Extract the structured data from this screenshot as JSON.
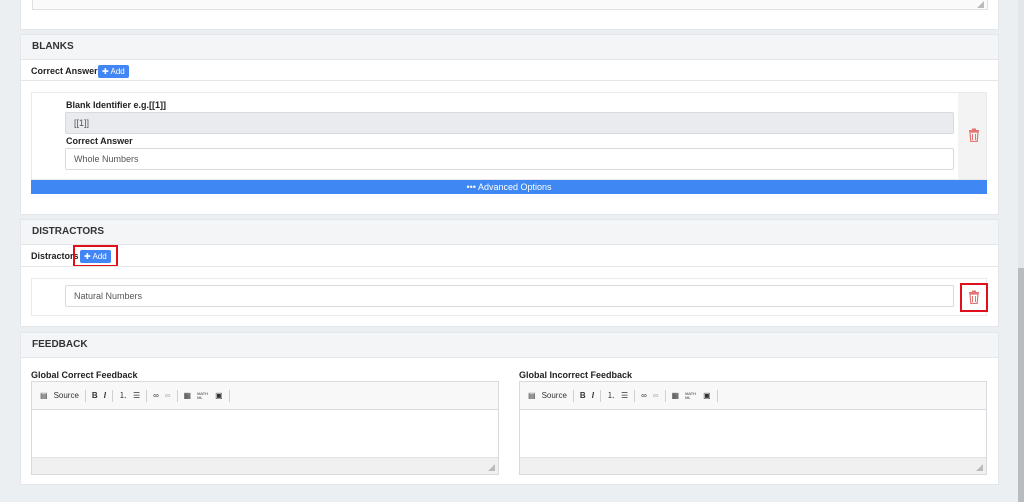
{
  "blanks": {
    "title": "BLANKS",
    "correct_answer_label": "Correct Answer",
    "add_label": "✚ Add",
    "identifier_label": "Blank Identifier e.g.[[1]]",
    "identifier_value": "[[1]]",
    "answer_label": "Correct Answer",
    "answer_value": "Whole Numbers",
    "advanced_label": "••• Advanced Options"
  },
  "distractors": {
    "title": "DISTRACTORS",
    "label": "Distractors",
    "add_label": "✚ Add",
    "item_value": "Natural Numbers"
  },
  "feedback": {
    "title": "FEEDBACK",
    "correct_label": "Global Correct Feedback",
    "incorrect_label": "Global Incorrect Feedback",
    "toolbar": {
      "source": "Source",
      "bold": "B",
      "italic": "I",
      "mathml": "MATH ML"
    }
  },
  "colors": {
    "accent": "#4285f4",
    "danger": "#e0101a",
    "trash": "#e57373"
  }
}
